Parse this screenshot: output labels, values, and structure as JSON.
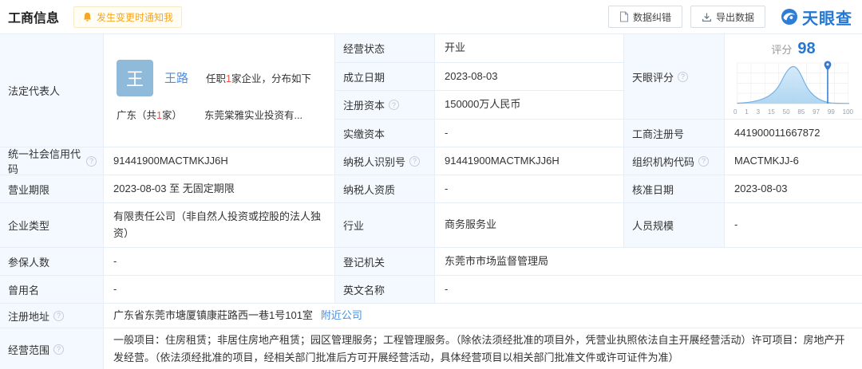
{
  "header": {
    "title": "工商信息",
    "notify_badge": "发生变更时通知我",
    "correction_button": "数据纠错",
    "export_button": "导出数据",
    "logo": "天眼查"
  },
  "icons": {
    "question": "?"
  },
  "legal_rep": {
    "label": "法定代表人",
    "avatar_char": "王",
    "name": "王路",
    "tenure_prefix": "任职",
    "tenure_count": "1",
    "tenure_suffix": "家企业，分布如下",
    "region_prefix": "广东（共",
    "region_count": "1",
    "region_suffix": "家）",
    "company": "东莞棠雅实业投资有..."
  },
  "fields": {
    "business_status": {
      "label": "经营状态",
      "value": "开业"
    },
    "establish_date": {
      "label": "成立日期",
      "value": "2023-08-03"
    },
    "registered_capital": {
      "label": "注册资本",
      "value": "150000万人民币"
    },
    "paidin_capital": {
      "label": "实缴资本",
      "value": "-"
    },
    "score": {
      "label": "天眼评分",
      "prefix": "评分",
      "value": "98",
      "ticks": [
        "0",
        "1",
        "3",
        "15",
        "50",
        "85",
        "97",
        "99",
        "100"
      ]
    },
    "reg_number": {
      "label": "工商注册号",
      "value": "441900011667872"
    },
    "credit_code": {
      "label": "统一社会信用代码",
      "value": "91441900MACTMKJJ6H"
    },
    "taxpayer_id": {
      "label": "纳税人识别号",
      "value": "91441900MACTMKJJ6H"
    },
    "org_code": {
      "label": "组织机构代码",
      "value": "MACTMKJJ-6"
    },
    "business_term": {
      "label": "营业期限",
      "value": "2023-08-03 至 无固定期限"
    },
    "taxpayer_qualification": {
      "label": "纳税人资质",
      "value": "-"
    },
    "approval_date": {
      "label": "核准日期",
      "value": "2023-08-03"
    },
    "company_type": {
      "label": "企业类型",
      "value": "有限责任公司（非自然人投资或控股的法人独资）"
    },
    "industry": {
      "label": "行业",
      "value": "商务服务业"
    },
    "staff_size": {
      "label": "人员规模",
      "value": "-"
    },
    "insured_count": {
      "label": "参保人数",
      "value": "-"
    },
    "registry_authority": {
      "label": "登记机关",
      "value": "东莞市市场监督管理局"
    },
    "former_name": {
      "label": "曾用名",
      "value": "-"
    },
    "english_name": {
      "label": "英文名称",
      "value": "-"
    },
    "registered_address": {
      "label": "注册地址",
      "value": "广东省东莞市塘厦镇康莊路西一巷1号101室",
      "link": "附近公司"
    },
    "business_scope": {
      "label": "经营范围",
      "value": "一般项目：住房租赁；非居住房地产租赁；园区管理服务；工程管理服务。（除依法须经批准的项目外，凭营业执照依法自主开展经营活动）许可项目：房地产开发经营。（依法须经批准的项目，经相关部门批准后方可开展经营活动，具体经营项目以相关部门批准文件或许可证件为准）"
    }
  },
  "chart_data": {
    "type": "area",
    "title": "天眼评分",
    "x_ticks": [
      "0",
      "1",
      "3",
      "15",
      "50",
      "85",
      "97",
      "99",
      "100"
    ],
    "curve_relative_heights": [
      0.02,
      0.03,
      0.08,
      0.45,
      1.0,
      0.35,
      0.04,
      0.02,
      0.02
    ],
    "marker_value": 98,
    "score_value": 98
  },
  "colors": {
    "accent_blue": "#2577d2",
    "link_blue": "#4a8fe2",
    "badge_orange": "#f5a623",
    "count_red": "#f2504d",
    "label_bg": "#f3f9fe",
    "border": "#e8eef7",
    "avatar_bg": "#90bada"
  }
}
